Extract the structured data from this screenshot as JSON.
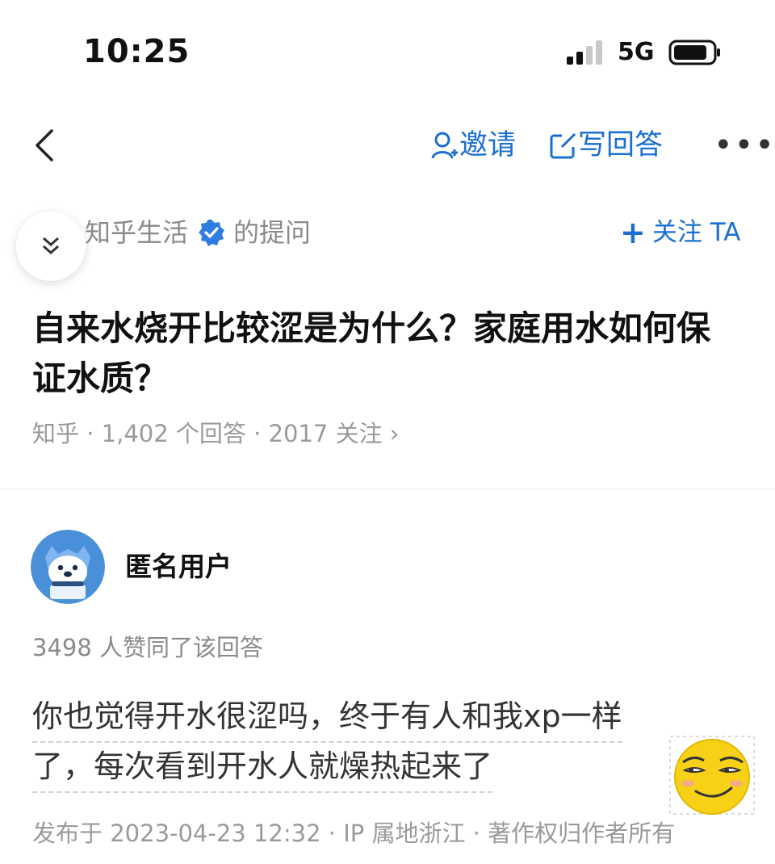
{
  "status_bar": {
    "time": "10:25",
    "network": "5G",
    "signal_bars": 4,
    "signal_active": 2
  },
  "nav": {
    "back_icon": "chevron-left-icon",
    "invite_label": "邀请",
    "write_answer_label": "写回答",
    "more_label": "•••"
  },
  "question": {
    "author": "知乎生活",
    "author_suffix": "的提问",
    "follow_label": "关注 TA",
    "title": "自来水烧开比较涩是为什么？家庭用水如何保证水质？",
    "meta": "知乎 · 1,402 个回答 · 2017 关注 ›"
  },
  "answer": {
    "username": "匿名用户",
    "votes_text": "3498 人赞同了该回答",
    "content_line1": "你也觉得开水很涩吗，终于有人和我xp一样",
    "content_line2": "了，每次看到开水人就燥热起来了",
    "footer": "发布于 2023-04-23 12:32 · IP 属地浙江 · 著作权归作者所有"
  },
  "colors": {
    "accent": "#1a6fd1",
    "verified": "#2f7de1",
    "muted": "#8a8a8a",
    "avatar_bg": "#4a90d9"
  }
}
